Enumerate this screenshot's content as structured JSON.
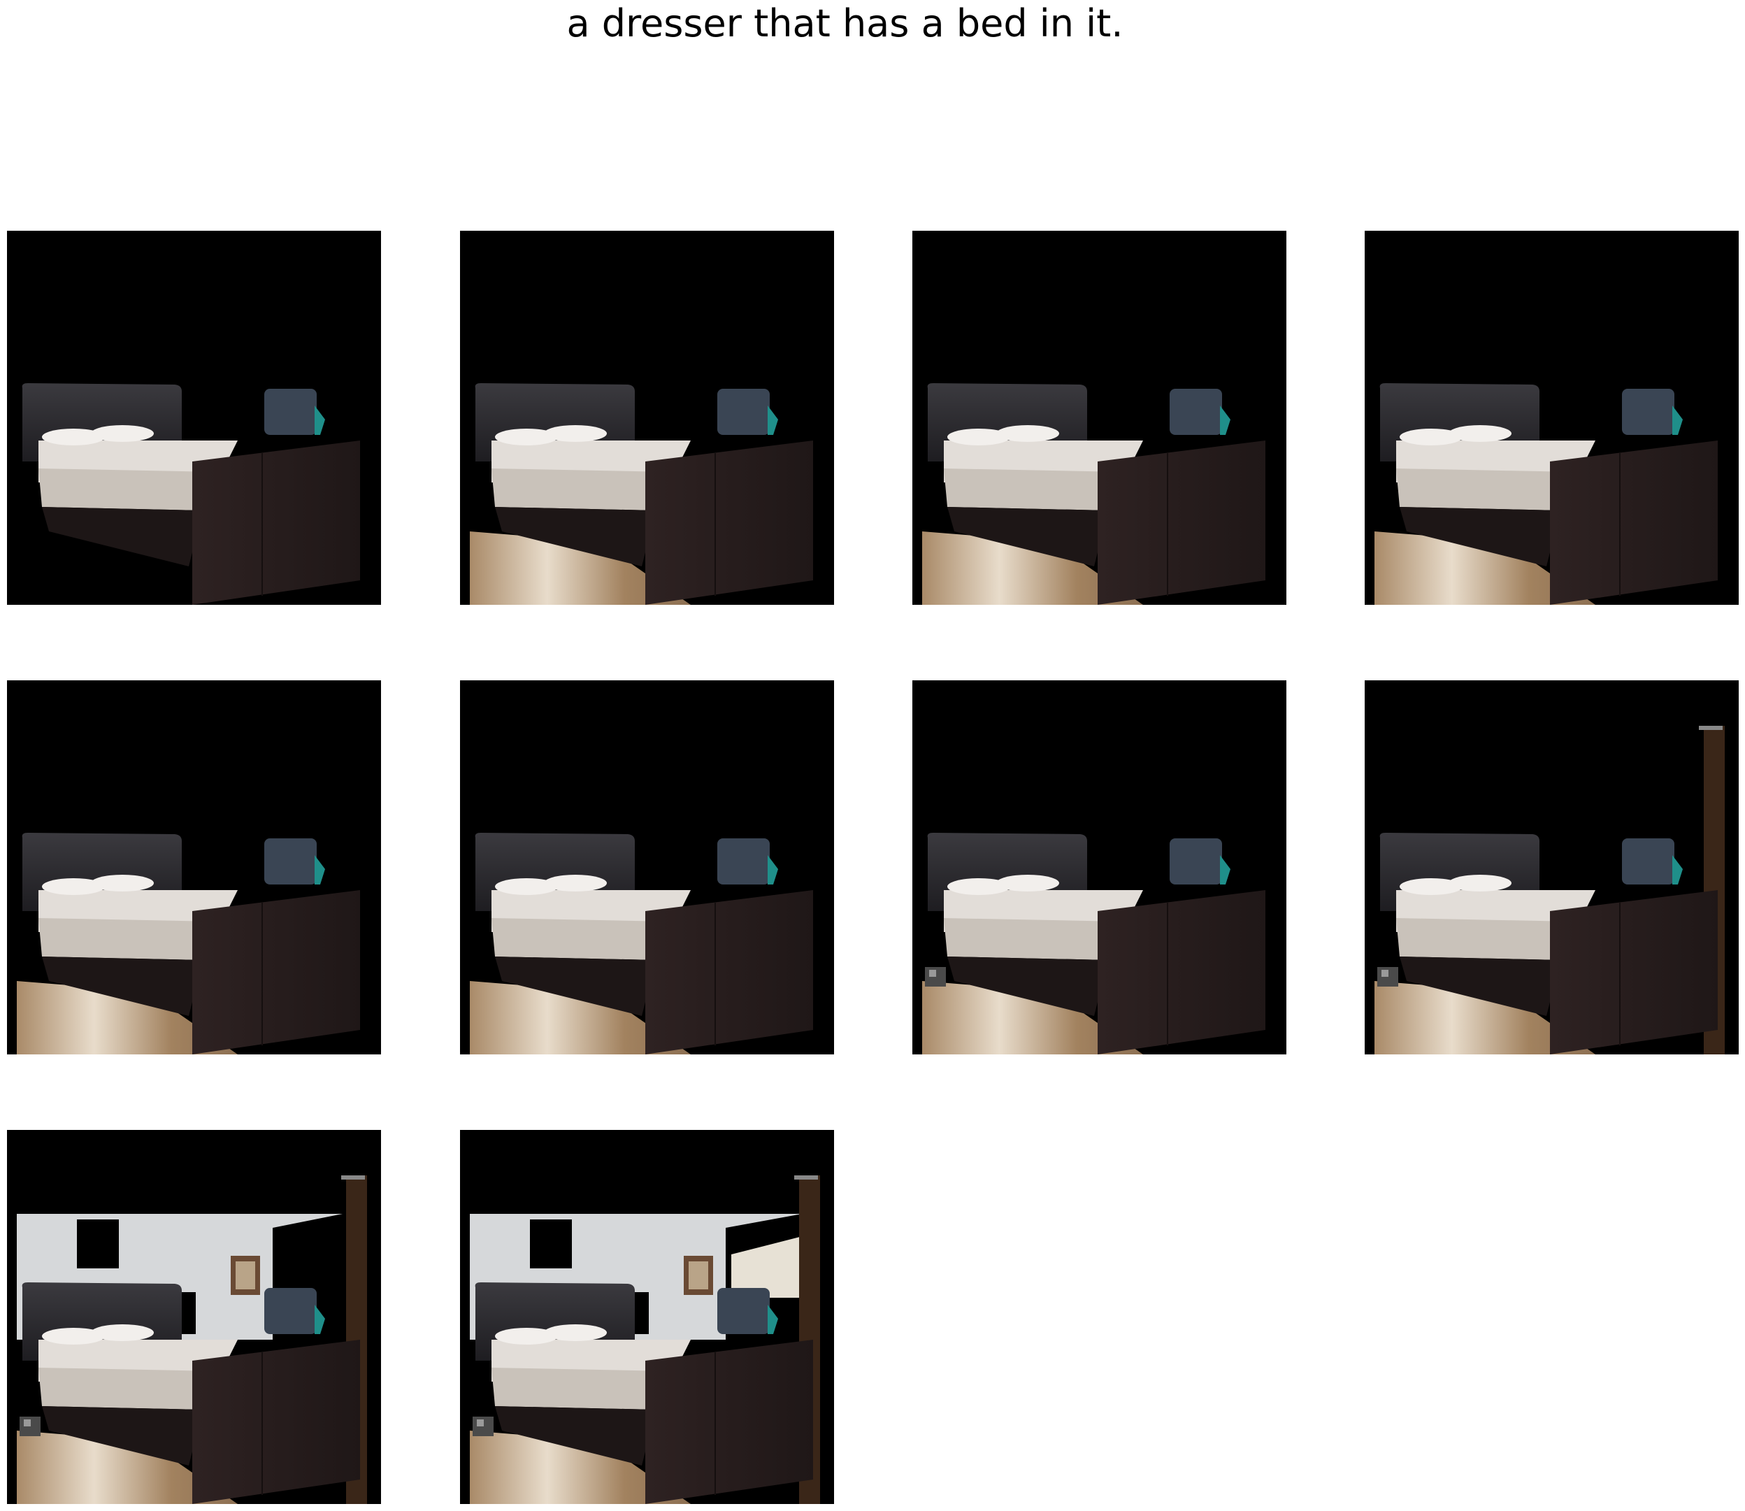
{
  "caption": "a dresser that has a bed in it.",
  "colors": {
    "background": "#ffffff",
    "panel_background": "#000000",
    "bed_frame": "#2b2020",
    "headboard": "#2a292d",
    "sheets": "#e2ddd8",
    "floor": "#b0926d",
    "wall": "#d6d8da",
    "tv_unit": "#3a4554"
  },
  "panels": [
    {
      "id": 1,
      "floor": false,
      "clutter": false,
      "pole": false,
      "wall": false,
      "window": false
    },
    {
      "id": 2,
      "floor": true,
      "clutter": false,
      "pole": false,
      "wall": false,
      "window": false
    },
    {
      "id": 3,
      "floor": true,
      "clutter": false,
      "pole": false,
      "wall": false,
      "window": false
    },
    {
      "id": 4,
      "floor": true,
      "clutter": false,
      "pole": false,
      "wall": false,
      "window": false
    },
    {
      "id": 5,
      "floor": true,
      "clutter": false,
      "pole": false,
      "wall": false,
      "window": false
    },
    {
      "id": 6,
      "floor": true,
      "clutter": false,
      "pole": false,
      "wall": false,
      "window": false
    },
    {
      "id": 7,
      "floor": true,
      "clutter": true,
      "pole": false,
      "wall": false,
      "window": false
    },
    {
      "id": 8,
      "floor": true,
      "clutter": true,
      "pole": true,
      "wall": false,
      "window": false
    },
    {
      "id": 9,
      "floor": true,
      "clutter": true,
      "pole": true,
      "wall": true,
      "window": false
    },
    {
      "id": 10,
      "floor": true,
      "clutter": true,
      "pole": true,
      "wall": true,
      "window": true
    }
  ]
}
